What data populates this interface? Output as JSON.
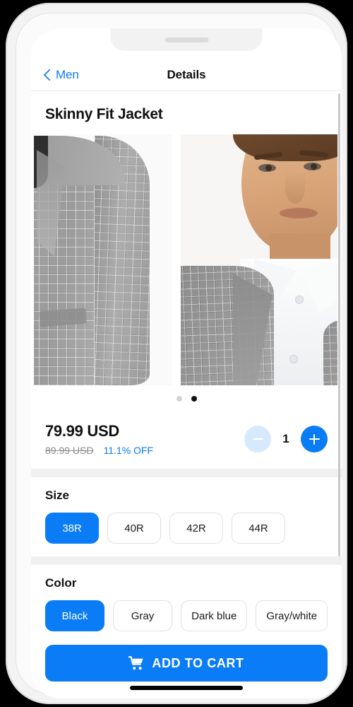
{
  "nav": {
    "back_label": "Men",
    "back_icon": "chevron-left-icon",
    "title": "Details"
  },
  "product": {
    "title": "Skinny Fit Jacket",
    "gallery": {
      "slides": [
        {
          "alt": "Grey checked skinny fit jacket on white background"
        },
        {
          "alt": "Male model wearing grey checked jacket with white shirt"
        }
      ],
      "dots": [
        {
          "state": "inactive"
        },
        {
          "state": "active"
        }
      ],
      "active_index": 1
    },
    "price": {
      "current": "79.99 USD",
      "original": "89.99 USD",
      "discount": "11.1% OFF"
    },
    "quantity": {
      "value": "1",
      "decrease_icon": "minus-icon",
      "increase_icon": "plus-icon",
      "decrease_enabled": false,
      "increase_enabled": true
    }
  },
  "options": [
    {
      "label": "Size",
      "values": [
        "38R",
        "40R",
        "42R",
        "44R"
      ],
      "selected": "38R"
    },
    {
      "label": "Color",
      "values": [
        "Black",
        "Gray",
        "Dark blue",
        "Gray/white"
      ],
      "selected": "Black"
    }
  ],
  "cta": {
    "label": "ADD TO CART",
    "icon": "shopping-cart-icon"
  },
  "colors": {
    "accent": "#0a7cf5",
    "accent_muted": "#d6e9fd",
    "text_primary": "#111111",
    "text_muted": "#8a8a8a",
    "page_background": "#f0f0f0",
    "dot_active": "#111111",
    "dot_inactive": "#d5d5d5"
  }
}
